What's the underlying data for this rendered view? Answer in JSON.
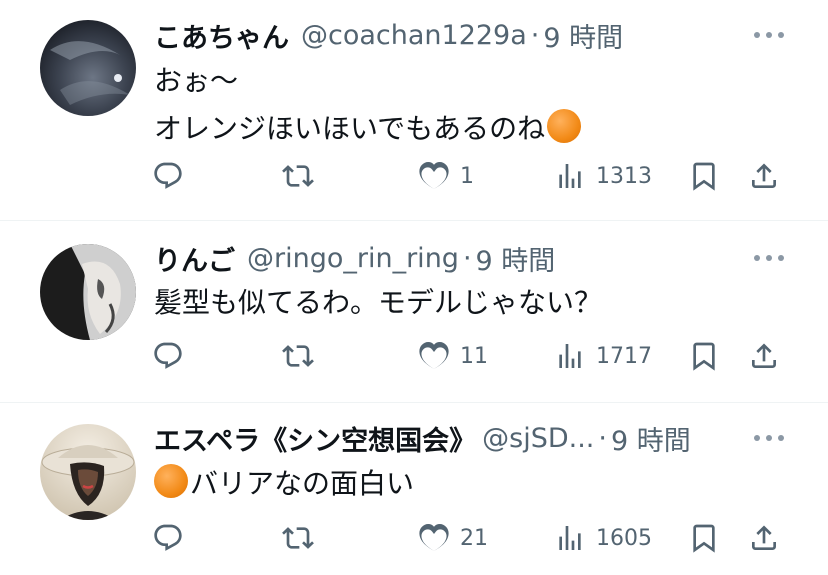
{
  "posts": [
    {
      "name": "こあちゃん",
      "handle": "@coachan1229a",
      "separator": "·",
      "time": "9 時間",
      "lines": [
        "おぉ〜",
        "オレンジほいほいでもあるのね"
      ],
      "trailing_emoji": "orange-circle-emoji",
      "replies": "",
      "reposts": "",
      "likes": "1",
      "views": "1313"
    },
    {
      "name": "りんご",
      "handle": "@ringo_rin_ring",
      "separator": "·",
      "time": "9 時間",
      "lines": [
        "髪型も似てるわ。モデルじゃない？"
      ],
      "replies": "",
      "reposts": "",
      "likes": "11",
      "views": "1717"
    },
    {
      "name": "エスペラ《シン空想国会》",
      "handle": "@sjSD...",
      "separator": "·",
      "time": "9 時間",
      "leading_emoji": "orange-circle-emoji",
      "lines": [
        "バリアなの面白い"
      ],
      "replies": "",
      "reposts": "",
      "likes": "21",
      "views": "1605"
    }
  ],
  "colors": {
    "text": "#0f1419",
    "muted": "#536471",
    "divider": "#eff3f4",
    "emoji": "#f28a17"
  },
  "icons": {
    "reply": "reply-icon",
    "repost": "repost-icon",
    "like": "heart-icon",
    "views": "views-icon",
    "bookmark": "bookmark-icon",
    "share": "share-icon",
    "more": "more-icon"
  }
}
